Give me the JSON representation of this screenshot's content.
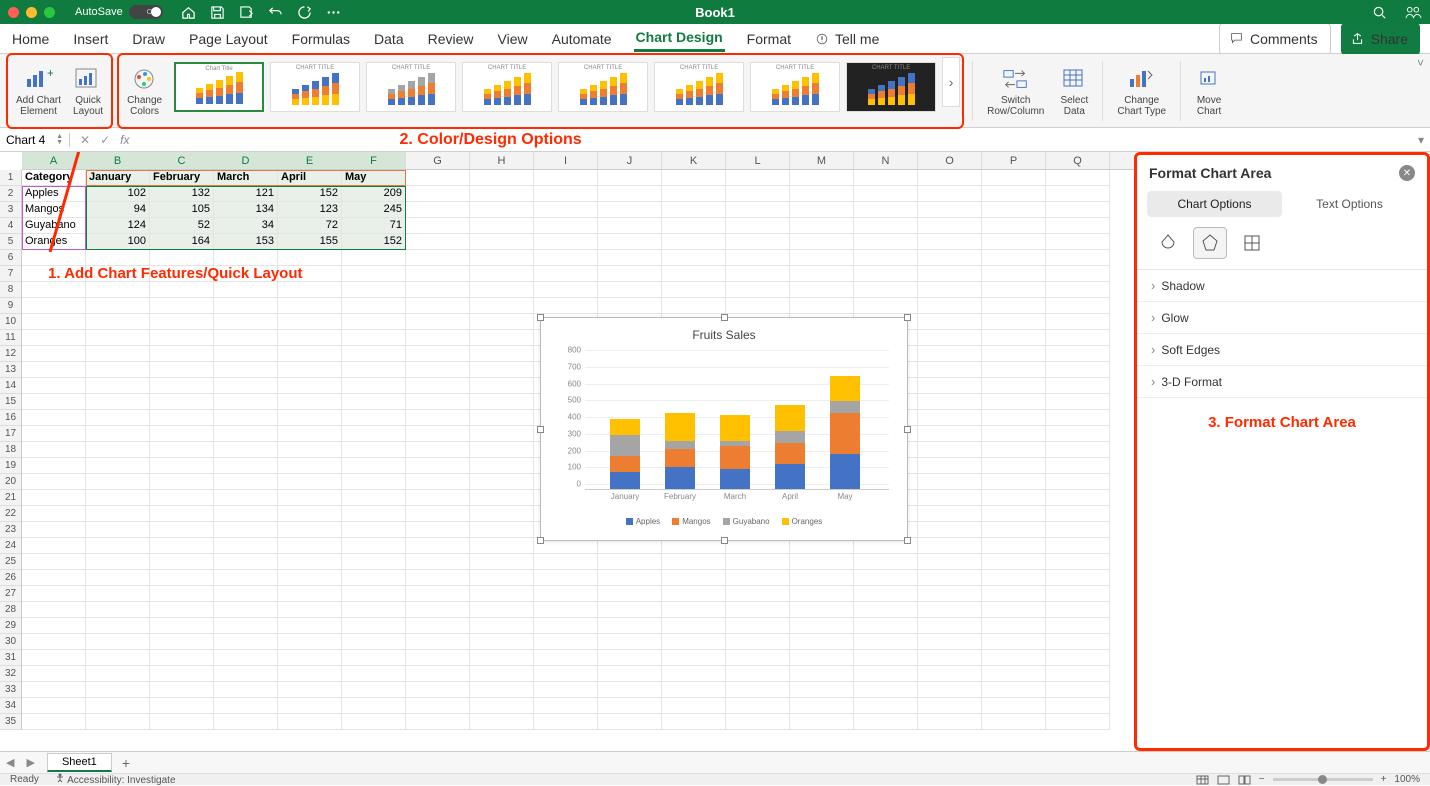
{
  "titlebar": {
    "autosave_label": "AutoSave",
    "autosave_state": "OFF",
    "title": "Book1"
  },
  "tabs": [
    "Home",
    "Insert",
    "Draw",
    "Page Layout",
    "Formulas",
    "Data",
    "Review",
    "View",
    "Automate",
    "Chart Design",
    "Format"
  ],
  "active_tab": "Chart Design",
  "tell_me": "Tell me",
  "comments_btn": "Comments",
  "share_btn": "Share",
  "ribbon": {
    "add_element": "Add Chart\nElement",
    "quick_layout": "Quick\nLayout",
    "change_colors": "Change\nColors",
    "switch_rc": "Switch\nRow/Column",
    "select_data": "Select\nData",
    "change_type": "Change\nChart Type",
    "move_chart": "Move\nChart",
    "style_thumb_title": "CHART TITLE"
  },
  "annotations": {
    "a1": "1. Add Chart Features/Quick Layout",
    "a2": "2. Color/Design Options",
    "a3": "3. Format Chart Area"
  },
  "namebox": "Chart 4",
  "sheet": {
    "columns": [
      "A",
      "B",
      "C",
      "D",
      "E",
      "F",
      "G",
      "H",
      "I",
      "J",
      "K",
      "L",
      "M",
      "N",
      "O",
      "P",
      "Q"
    ],
    "headers": [
      "Category",
      "January",
      "February",
      "March",
      "April",
      "May"
    ],
    "rows": [
      {
        "name": "Apples",
        "vals": [
          102,
          132,
          121,
          152,
          209
        ]
      },
      {
        "name": "Mangos",
        "vals": [
          94,
          105,
          134,
          123,
          245
        ]
      },
      {
        "name": "Guyabano",
        "vals": [
          124,
          52,
          34,
          72,
          71
        ]
      },
      {
        "name": "Oranges",
        "vals": [
          100,
          164,
          153,
          155,
          152
        ]
      }
    ],
    "row_count": 35
  },
  "chart_data": {
    "type": "bar",
    "stacked": true,
    "title": "Fruits Sales",
    "categories": [
      "January",
      "February",
      "March",
      "April",
      "May"
    ],
    "series": [
      {
        "name": "Apples",
        "color": "#4472c4",
        "values": [
          102,
          132,
          121,
          152,
          209
        ]
      },
      {
        "name": "Mangos",
        "color": "#ed7d31",
        "values": [
          94,
          105,
          134,
          123,
          245
        ]
      },
      {
        "name": "Guyabano",
        "color": "#a5a5a5",
        "values": [
          124,
          52,
          34,
          72,
          71
        ]
      },
      {
        "name": "Oranges",
        "color": "#ffc000",
        "values": [
          100,
          164,
          153,
          155,
          152
        ]
      }
    ],
    "ylim": [
      0,
      800
    ],
    "ystep": 100,
    "xlabel": "",
    "ylabel": ""
  },
  "format_pane": {
    "title": "Format Chart Area",
    "tab_opts": "Chart Options",
    "tab_text": "Text Options",
    "sections": [
      "Shadow",
      "Glow",
      "Soft Edges",
      "3-D Format"
    ]
  },
  "sheettab": "Sheet1",
  "status": {
    "ready": "Ready",
    "access": "Accessibility: Investigate",
    "zoom": "100%"
  }
}
